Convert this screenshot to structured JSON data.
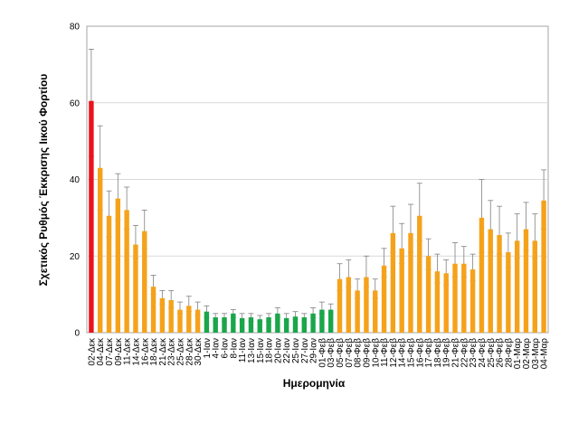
{
  "chart_data": {
    "type": "bar",
    "xlabel": "Ημερομηνία",
    "ylabel": "Σχετικός Ρυθμός Έκκρισης Ιικού Φορτίου",
    "ylim": [
      0,
      80
    ],
    "yticks": [
      0,
      20,
      40,
      60,
      80
    ],
    "grid": true,
    "colors": {
      "first": "#e8141b",
      "low": "#1aa64a",
      "default": "#f5a21b",
      "error_bar": "#808080",
      "grid": "#d9d9d9",
      "frame": "#a6a6a6"
    },
    "categories": [
      "02-Δεκ",
      "04-Δεκ",
      "07-Δεκ",
      "09-Δεκ",
      "11-Δεκ",
      "14-Δεκ",
      "16-Δεκ",
      "18-Δεκ",
      "21-Δεκ",
      "23-Δεκ",
      "25-Δεκ",
      "28-Δεκ",
      "30-Δεκ",
      "1-Ιαν",
      "4-Ιαν",
      "6-Ιαν",
      "8-Ιαν",
      "11-Ιαν",
      "13-Ιαν",
      "15-Ιαν",
      "18-Ιαν",
      "20-Ιαν",
      "22-Ιαν",
      "25-Ιαν",
      "27-Ιαν",
      "29-Ιαν",
      "01-Φεβ",
      "03-Φεβ",
      "05-Φεβ",
      "07-Φεβ",
      "08-Φεβ",
      "09-Φεβ",
      "10-Φεβ",
      "11-Φεβ",
      "12-Φεβ",
      "14-Φεβ",
      "15-Φεβ",
      "16-Φεβ",
      "17-Φεβ",
      "18-Φεβ",
      "19-Φεβ",
      "21-Φεβ",
      "22-Φεβ",
      "23-Φεβ",
      "24-Φεβ",
      "25-Φεβ",
      "26-Φεβ",
      "28-Φεβ",
      "01-Μαρ",
      "02-Μαρ",
      "03-Μαρ",
      "04-Μαρ"
    ],
    "values": [
      60.5,
      43,
      30.5,
      35,
      32,
      23,
      26.5,
      12,
      9,
      8.5,
      6,
      7,
      6,
      5.5,
      4,
      4,
      5,
      3.8,
      4,
      3.5,
      4,
      5,
      3.8,
      4.2,
      4,
      5,
      6,
      6,
      14,
      14.5,
      11,
      14.5,
      11,
      17.5,
      26,
      22,
      26,
      30.5,
      20,
      16,
      15.5,
      18,
      18,
      16.5,
      30,
      27,
      25.5,
      21,
      24,
      27,
      24,
      34.5
    ],
    "error_low": [
      46,
      32,
      25,
      29.5,
      27,
      19.5,
      22,
      10,
      7.5,
      6.5,
      5,
      5.5,
      4.5,
      4,
      3,
      3,
      4,
      3,
      3,
      3,
      3,
      4,
      3,
      3.5,
      3,
      4,
      5,
      5,
      11,
      12,
      9,
      12,
      9,
      14.5,
      21,
      18,
      21,
      24,
      16.5,
      13,
      12.5,
      14.5,
      14.5,
      13.5,
      21,
      21,
      20.5,
      17,
      19.5,
      21.5,
      19.5,
      27
    ],
    "error_high": [
      74,
      54,
      37,
      41.5,
      38,
      28,
      32,
      15,
      11,
      11,
      8,
      9.5,
      8,
      7,
      5,
      5,
      6,
      5,
      5,
      4.5,
      5,
      6.5,
      5,
      5.5,
      5,
      6.5,
      8,
      7.5,
      18,
      19,
      14,
      20,
      14,
      22,
      33,
      28.5,
      33.5,
      39,
      24.5,
      20.5,
      19,
      23.5,
      22.5,
      20.5,
      40,
      34.5,
      33,
      26,
      31,
      34,
      31,
      42.5
    ],
    "bar_color_groups": [
      "first",
      "default",
      "default",
      "default",
      "default",
      "default",
      "default",
      "default",
      "default",
      "default",
      "default",
      "default",
      "default",
      "low",
      "low",
      "low",
      "low",
      "low",
      "low",
      "low",
      "low",
      "low",
      "low",
      "low",
      "low",
      "low",
      "low",
      "low",
      "default",
      "default",
      "default",
      "default",
      "default",
      "default",
      "default",
      "default",
      "default",
      "default",
      "default",
      "default",
      "default",
      "default",
      "default",
      "default",
      "default",
      "default",
      "default",
      "default",
      "default",
      "default",
      "default",
      "default"
    ]
  }
}
